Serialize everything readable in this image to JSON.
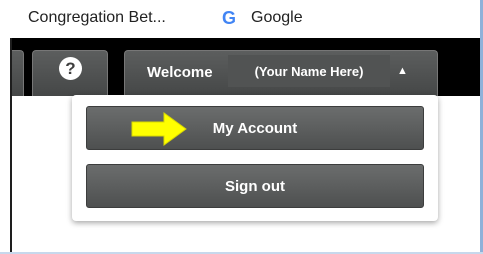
{
  "bookmarks": [
    {
      "label": "Congregation Bet..."
    },
    {
      "icon": "google-g-icon",
      "label": "Google"
    }
  ],
  "bookmarks_close": "×",
  "toolbar": {
    "help_symbol": "?",
    "welcome_label": "Welcome",
    "user_name": "(Your Name Here)",
    "caret": "▲"
  },
  "menu": {
    "items": [
      {
        "label": "My Account"
      },
      {
        "label": "Sign out"
      }
    ]
  },
  "colors": {
    "toolbar_bg": "#000000",
    "tab_bg": "#505252",
    "arrow": "#ffff00"
  }
}
